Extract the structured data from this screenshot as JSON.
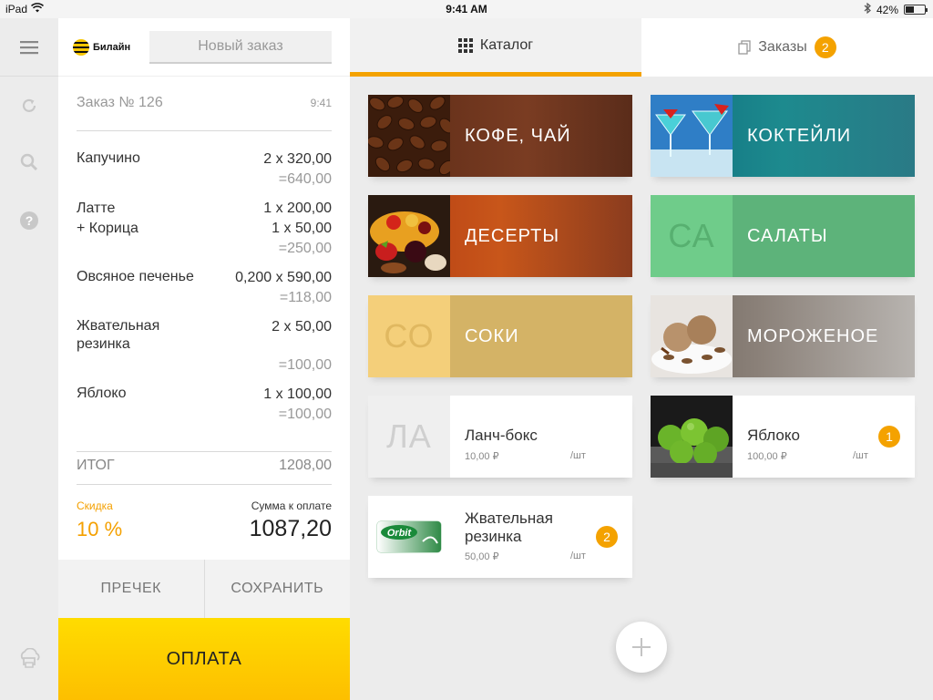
{
  "status": {
    "device": "iPad",
    "time": "9:41 AM",
    "battery": "42%"
  },
  "brand": {
    "name": "Билайн"
  },
  "order": {
    "new_order_tab": "Новый заказ",
    "title": "Заказ № 126",
    "time": "9:41",
    "items": [
      {
        "name": "Капучино",
        "qty": "2 x 320,00",
        "sum": "=640,00"
      },
      {
        "name": "Латте\n+ Корица",
        "qty": "1 x 200,00\n1 x 50,00",
        "sum": "=250,00"
      },
      {
        "name": "Овсяное печенье",
        "qty": "0,200 x 590,00",
        "sum": "=118,00"
      },
      {
        "name": "Жвательная\nрезинка",
        "qty": "2 x 50,00",
        "sum": "=100,00"
      },
      {
        "name": "Яблоко",
        "qty": "1 x 100,00",
        "sum": "=100,00"
      }
    ],
    "total_label": "ИТОГ",
    "total_value": "1208,00",
    "discount_label": "Скидка",
    "discount_value": "10 %",
    "pay_sum_label": "Сумма к оплате",
    "pay_sum_value": "1087,20",
    "precheck_label": "ПРЕЧЕК",
    "save_label": "СОХРАНИТЬ",
    "pay_label": "ОПЛАТА"
  },
  "tabs": {
    "catalog": "Каталог",
    "orders": "Заказы",
    "orders_count": "2"
  },
  "categories": {
    "coffee": "КОФЕ, ЧАЙ",
    "cocktails": "КОКТЕЙЛИ",
    "desserts": "ДЕСЕРТЫ",
    "salads": "САЛАТЫ",
    "salads_abbr": "СА",
    "juices": "СОКИ",
    "juices_abbr": "СО",
    "icecream": "МОРОЖЕНОЕ"
  },
  "products": {
    "lunch": {
      "abbr": "ЛА",
      "name": "Ланч-бокс",
      "price": "10,00 ₽",
      "unit": "/шт"
    },
    "apple": {
      "name": "Яблоко",
      "price": "100,00 ₽",
      "unit": "/шт",
      "count": "1"
    },
    "gum": {
      "name": "Жвательная\nрезинка",
      "price": "50,00 ₽",
      "unit": "/шт",
      "count": "2",
      "pack_text": "Orbit"
    }
  },
  "colors": {
    "accent": "#f4a200",
    "salads": "#5db37a",
    "juices": "#d4b366"
  }
}
